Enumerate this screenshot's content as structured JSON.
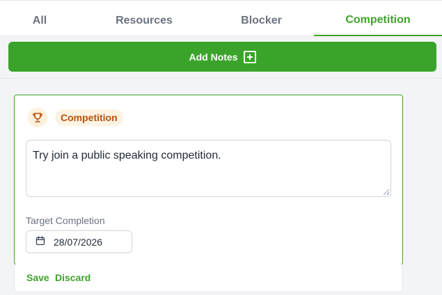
{
  "tabs": [
    {
      "label": "All",
      "active": false
    },
    {
      "label": "Resources",
      "active": false
    },
    {
      "label": "Blocker",
      "active": false
    },
    {
      "label": "Competition",
      "active": true
    }
  ],
  "toolbar": {
    "add_notes_label": "Add Notes",
    "add_icon": "plus-square-icon"
  },
  "note": {
    "category_icon": "trophy-icon",
    "category_label": "Competition",
    "text": "Try join a public speaking competition.",
    "target_label": "Target Completion",
    "target_date": "28/07/2026",
    "date_icon": "calendar-icon"
  },
  "actions": {
    "save_label": "Save",
    "discard_label": "Discard"
  },
  "colors": {
    "accent": "#3aa42a",
    "badge_text": "#b5520f",
    "badge_bg": "#fdf3e3"
  }
}
